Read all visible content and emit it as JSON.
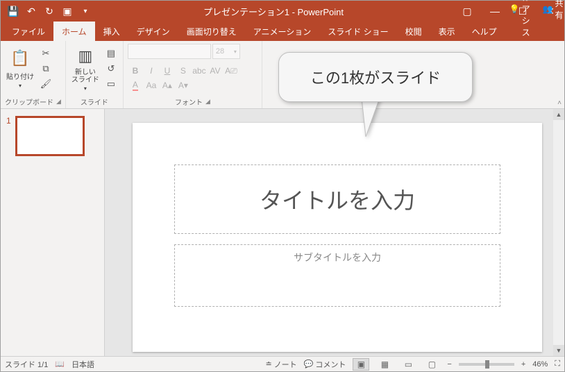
{
  "title": "プレゼンテーション1  -  PowerPoint",
  "tabs": {
    "file": "ファイル",
    "home": "ホーム",
    "insert": "挿入",
    "design": "デザイン",
    "transitions": "画面切り替え",
    "animations": "アニメーション",
    "slideshow": "スライド ショー",
    "review": "校閲",
    "view": "表示",
    "help": "ヘルプ",
    "tellme": "操作アシス",
    "share": "共有"
  },
  "ribbon": {
    "clipboard": {
      "label": "クリップボード",
      "paste": "貼り付け"
    },
    "slides": {
      "label": "スライド",
      "new_slide": "新しい\nスライド"
    },
    "font": {
      "label": "フォント",
      "size": "28"
    }
  },
  "callout": "この1枚がスライド",
  "thumbs": {
    "n1": "1"
  },
  "slide": {
    "title_placeholder": "タイトルを入力",
    "subtitle_placeholder": "サブタイトルを入力"
  },
  "status": {
    "slide_indicator": "スライド 1/1",
    "language": "日本語",
    "notes": "ノート",
    "comments": "コメント",
    "zoom": "46%",
    "minus": "−",
    "plus": "+"
  }
}
